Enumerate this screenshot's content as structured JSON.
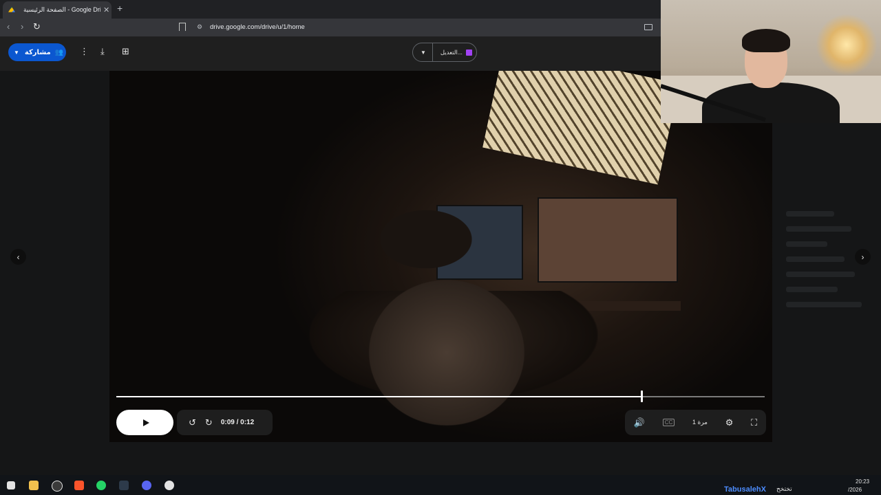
{
  "browser": {
    "tab_title": "الصفحة الرئيسية - Google Drive",
    "new_tab_symbol": "+",
    "url": "drive.google.com/drive/u/1/home"
  },
  "viewer": {
    "share_label": "مشاركة",
    "edit_label": "التعديل...",
    "current_time": "0:09",
    "duration": "0:12",
    "time_display": "0:09 / 0:12",
    "progress_fraction": 0.81,
    "speed_label": "1 مرة"
  },
  "taskbar": {
    "username": "TabusalehX",
    "arabic_text": "تختخح",
    "clock_time": "20:23",
    "clock_date": "/2026"
  },
  "colors": {
    "share_button": "#0b57d0",
    "username_text": "#4d8dff"
  }
}
